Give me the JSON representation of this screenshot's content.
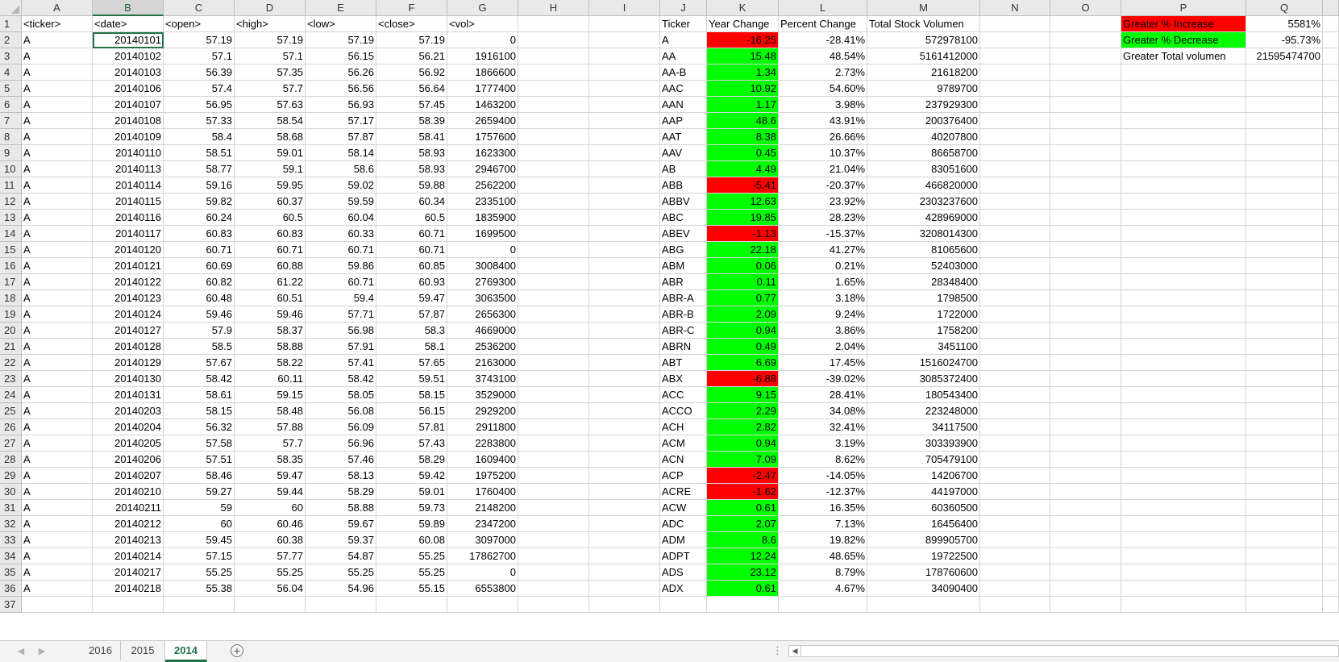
{
  "columns": [
    {
      "letter": "",
      "width": 27
    },
    {
      "letter": "A",
      "width": 88
    },
    {
      "letter": "B",
      "width": 88
    },
    {
      "letter": "C",
      "width": 88
    },
    {
      "letter": "D",
      "width": 88
    },
    {
      "letter": "E",
      "width": 88
    },
    {
      "letter": "F",
      "width": 88
    },
    {
      "letter": "G",
      "width": 88
    },
    {
      "letter": "H",
      "width": 88
    },
    {
      "letter": "I",
      "width": 88
    },
    {
      "letter": "J",
      "width": 58
    },
    {
      "letter": "K",
      "width": 89
    },
    {
      "letter": "L",
      "width": 110
    },
    {
      "letter": "M",
      "width": 140
    },
    {
      "letter": "N",
      "width": 87
    },
    {
      "letter": "O",
      "width": 88
    },
    {
      "letter": "P",
      "width": 155
    },
    {
      "letter": "Q",
      "width": 95
    },
    {
      "letter": "",
      "width": 20
    }
  ],
  "selected_column": "B",
  "headers": {
    "A": "<ticker>",
    "B": "<date>",
    "C": "<open>",
    "D": "<high>",
    "E": "<low>",
    "F": "<close>",
    "G": "<vol>",
    "J": "Ticker",
    "K": "Year Change",
    "L": "Percent Change",
    "M": "Total Stock Volumen"
  },
  "raw_rows": [
    [
      "A",
      "20140101",
      "57.19",
      "57.19",
      "57.19",
      "57.19",
      "0"
    ],
    [
      "A",
      "20140102",
      "57.1",
      "57.1",
      "56.15",
      "56.21",
      "1916100"
    ],
    [
      "A",
      "20140103",
      "56.39",
      "57.35",
      "56.26",
      "56.92",
      "1866600"
    ],
    [
      "A",
      "20140106",
      "57.4",
      "57.7",
      "56.56",
      "56.64",
      "1777400"
    ],
    [
      "A",
      "20140107",
      "56.95",
      "57.63",
      "56.93",
      "57.45",
      "1463200"
    ],
    [
      "A",
      "20140108",
      "57.33",
      "58.54",
      "57.17",
      "58.39",
      "2659400"
    ],
    [
      "A",
      "20140109",
      "58.4",
      "58.68",
      "57.87",
      "58.41",
      "1757600"
    ],
    [
      "A",
      "20140110",
      "58.51",
      "59.01",
      "58.14",
      "58.93",
      "1623300"
    ],
    [
      "A",
      "20140113",
      "58.77",
      "59.1",
      "58.6",
      "58.93",
      "2946700"
    ],
    [
      "A",
      "20140114",
      "59.16",
      "59.95",
      "59.02",
      "59.88",
      "2562200"
    ],
    [
      "A",
      "20140115",
      "59.82",
      "60.37",
      "59.59",
      "60.34",
      "2335100"
    ],
    [
      "A",
      "20140116",
      "60.24",
      "60.5",
      "60.04",
      "60.5",
      "1835900"
    ],
    [
      "A",
      "20140117",
      "60.83",
      "60.83",
      "60.33",
      "60.71",
      "1699500"
    ],
    [
      "A",
      "20140120",
      "60.71",
      "60.71",
      "60.71",
      "60.71",
      "0"
    ],
    [
      "A",
      "20140121",
      "60.69",
      "60.88",
      "59.86",
      "60.85",
      "3008400"
    ],
    [
      "A",
      "20140122",
      "60.82",
      "61.22",
      "60.71",
      "60.93",
      "2769300"
    ],
    [
      "A",
      "20140123",
      "60.48",
      "60.51",
      "59.4",
      "59.47",
      "3063500"
    ],
    [
      "A",
      "20140124",
      "59.46",
      "59.46",
      "57.71",
      "57.87",
      "2656300"
    ],
    [
      "A",
      "20140127",
      "57.9",
      "58.37",
      "56.98",
      "58.3",
      "4669000"
    ],
    [
      "A",
      "20140128",
      "58.5",
      "58.88",
      "57.91",
      "58.1",
      "2536200"
    ],
    [
      "A",
      "20140129",
      "57.67",
      "58.22",
      "57.41",
      "57.65",
      "2163000"
    ],
    [
      "A",
      "20140130",
      "58.42",
      "60.11",
      "58.42",
      "59.51",
      "3743100"
    ],
    [
      "A",
      "20140131",
      "58.61",
      "59.15",
      "58.05",
      "58.15",
      "3529000"
    ],
    [
      "A",
      "20140203",
      "58.15",
      "58.48",
      "56.08",
      "56.15",
      "2929200"
    ],
    [
      "A",
      "20140204",
      "56.32",
      "57.88",
      "56.09",
      "57.81",
      "2911800"
    ],
    [
      "A",
      "20140205",
      "57.58",
      "57.7",
      "56.96",
      "57.43",
      "2283800"
    ],
    [
      "A",
      "20140206",
      "57.51",
      "58.35",
      "57.46",
      "58.29",
      "1609400"
    ],
    [
      "A",
      "20140207",
      "58.46",
      "59.47",
      "58.13",
      "59.42",
      "1975200"
    ],
    [
      "A",
      "20140210",
      "59.27",
      "59.44",
      "58.29",
      "59.01",
      "1760400"
    ],
    [
      "A",
      "20140211",
      "59",
      "60",
      "58.88",
      "59.73",
      "2148200"
    ],
    [
      "A",
      "20140212",
      "60",
      "60.46",
      "59.67",
      "59.89",
      "2347200"
    ],
    [
      "A",
      "20140213",
      "59.45",
      "60.38",
      "59.37",
      "60.08",
      "3097000"
    ],
    [
      "A",
      "20140214",
      "57.15",
      "57.77",
      "54.87",
      "55.25",
      "17862700"
    ],
    [
      "A",
      "20140217",
      "55.25",
      "55.25",
      "55.25",
      "55.25",
      "0"
    ],
    [
      "A",
      "20140218",
      "55.38",
      "56.04",
      "54.96",
      "55.15",
      "6553800"
    ]
  ],
  "summary_rows": [
    [
      "A",
      "-16.25",
      "-28.41%",
      "572978100"
    ],
    [
      "AA",
      "15.48",
      "48.54%",
      "5161412000"
    ],
    [
      "AA-B",
      "1.34",
      "2.73%",
      "21618200"
    ],
    [
      "AAC",
      "10.92",
      "54.60%",
      "9789700"
    ],
    [
      "AAN",
      "1.17",
      "3.98%",
      "237929300"
    ],
    [
      "AAP",
      "48.6",
      "43.91%",
      "200376400"
    ],
    [
      "AAT",
      "8.38",
      "26.66%",
      "40207800"
    ],
    [
      "AAV",
      "0.45",
      "10.37%",
      "86658700"
    ],
    [
      "AB",
      "4.49",
      "21.04%",
      "83051600"
    ],
    [
      "ABB",
      "-5.41",
      "-20.37%",
      "466820000"
    ],
    [
      "ABBV",
      "12.63",
      "23.92%",
      "2303237600"
    ],
    [
      "ABC",
      "19.85",
      "28.23%",
      "428969000"
    ],
    [
      "ABEV",
      "-1.13",
      "-15.37%",
      "3208014300"
    ],
    [
      "ABG",
      "22.18",
      "41.27%",
      "81065600"
    ],
    [
      "ABM",
      "0.06",
      "0.21%",
      "52403000"
    ],
    [
      "ABR",
      "0.11",
      "1.65%",
      "28348400"
    ],
    [
      "ABR-A",
      "0.77",
      "3.18%",
      "1798500"
    ],
    [
      "ABR-B",
      "2.09",
      "9.24%",
      "1722000"
    ],
    [
      "ABR-C",
      "0.94",
      "3.86%",
      "1758200"
    ],
    [
      "ABRN",
      "0.49",
      "2.04%",
      "3451100"
    ],
    [
      "ABT",
      "6.69",
      "17.45%",
      "1516024700"
    ],
    [
      "ABX",
      "-6.88",
      "-39.02%",
      "3085372400"
    ],
    [
      "ACC",
      "9.15",
      "28.41%",
      "180543400"
    ],
    [
      "ACCO",
      "2.29",
      "34.08%",
      "223248000"
    ],
    [
      "ACH",
      "2.82",
      "32.41%",
      "34117500"
    ],
    [
      "ACM",
      "0.94",
      "3.19%",
      "303393900"
    ],
    [
      "ACN",
      "7.09",
      "8.62%",
      "705479100"
    ],
    [
      "ACP",
      "-2.47",
      "-14.05%",
      "14206700"
    ],
    [
      "ACRE",
      "-1.62",
      "-12.37%",
      "44197000"
    ],
    [
      "ACW",
      "0.61",
      "16.35%",
      "60360500"
    ],
    [
      "ADC",
      "2.07",
      "7.13%",
      "16456400"
    ],
    [
      "ADM",
      "8.6",
      "19.82%",
      "899905700"
    ],
    [
      "ADPT",
      "12.24",
      "48.65%",
      "19722500"
    ],
    [
      "ADS",
      "23.12",
      "8.79%",
      "178760600"
    ],
    [
      "ADX",
      "0.61",
      "4.67%",
      "34090400"
    ]
  ],
  "stats": [
    {
      "label": "Greater % Increase",
      "value": "5581%",
      "color": "#ff0000"
    },
    {
      "label": "Greater % Decrease",
      "value": "-95.73%",
      "color": "#00ff00"
    },
    {
      "label": "Greater Total volumen",
      "value": "21595474700",
      "color": ""
    }
  ],
  "colors": {
    "positive": "#00ff00",
    "negative": "#ff0000",
    "accent": "#217346"
  },
  "tabs": [
    {
      "label": "2016",
      "active": false
    },
    {
      "label": "2015",
      "active": false
    },
    {
      "label": "2014",
      "active": true
    }
  ],
  "icons": {
    "prev_sheet": "caret-left-icon",
    "next_sheet": "caret-right-icon",
    "add_sheet": "plus-circle-icon",
    "more": "ellipsis-icon"
  }
}
